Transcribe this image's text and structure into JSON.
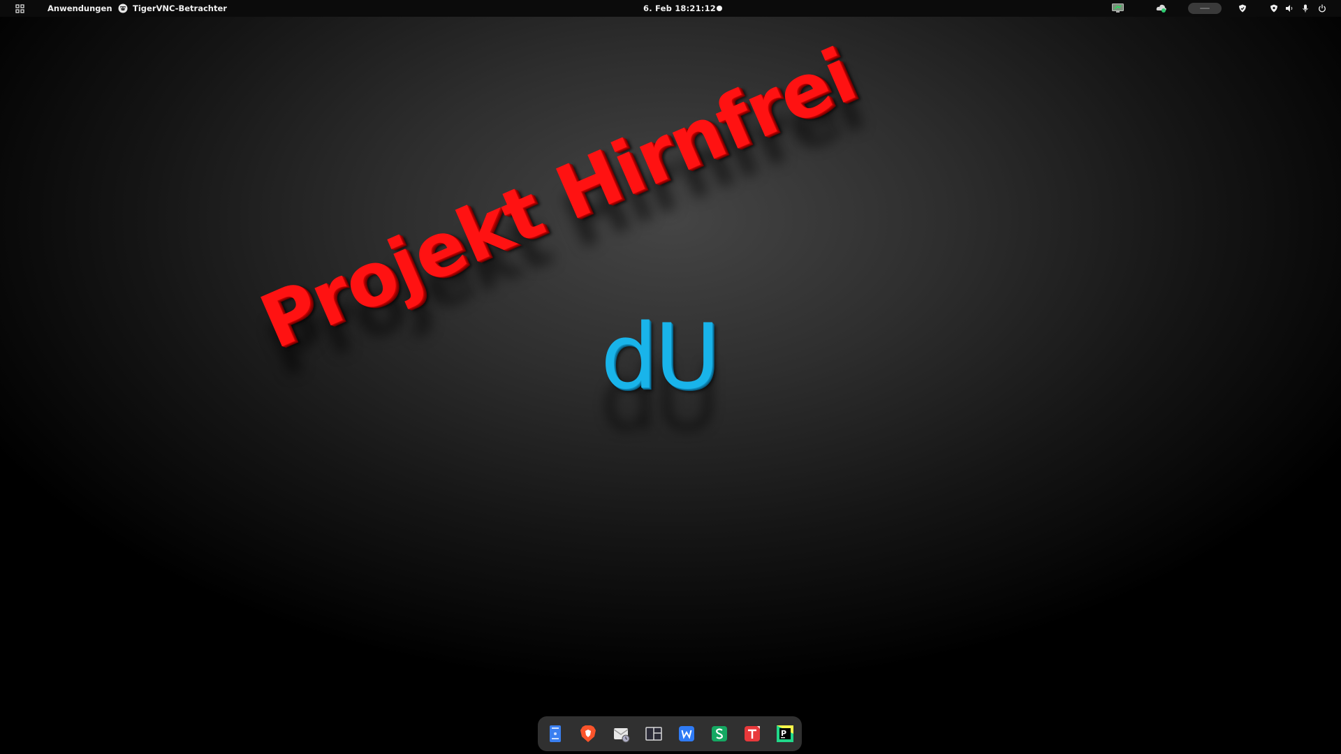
{
  "topbar": {
    "apps_label": "Anwendungen",
    "window_title": "TigerVNC-Betrachter",
    "clock": "6. Feb  18:21:12"
  },
  "wallpaper": {
    "title": "Projekt Hirnfrei",
    "logo": "dU",
    "title_color": "#ff1212",
    "logo_color": "#19b4ea"
  },
  "tray_icons": [
    "screen-share-icon",
    "cloud-sync-icon",
    "input-indicator",
    "shield-icon",
    "vpn-shield-icon",
    "volume-icon",
    "microphone-icon",
    "power-icon"
  ],
  "dock": {
    "items": [
      {
        "name": "file-manager",
        "icon": "file-manager-icon",
        "color": "#3a7ff0"
      },
      {
        "name": "brave-browser",
        "icon": "brave-icon",
        "color": "#fb542b"
      },
      {
        "name": "mail-client",
        "icon": "mail-icon",
        "color": "#e8e8e8"
      },
      {
        "name": "screen-layout",
        "icon": "screen-layout-icon",
        "color": "#2b2b38"
      },
      {
        "name": "wps-writer",
        "icon": "wps-writer-icon",
        "color": "#2f7bf5"
      },
      {
        "name": "wps-spreadsheets",
        "icon": "wps-spreadsheets-icon",
        "color": "#15a862"
      },
      {
        "name": "wps-presentation",
        "icon": "wps-presentation-icon",
        "color": "#e8393b"
      },
      {
        "name": "pycharm",
        "icon": "pycharm-icon",
        "color": "#21d789"
      }
    ]
  }
}
